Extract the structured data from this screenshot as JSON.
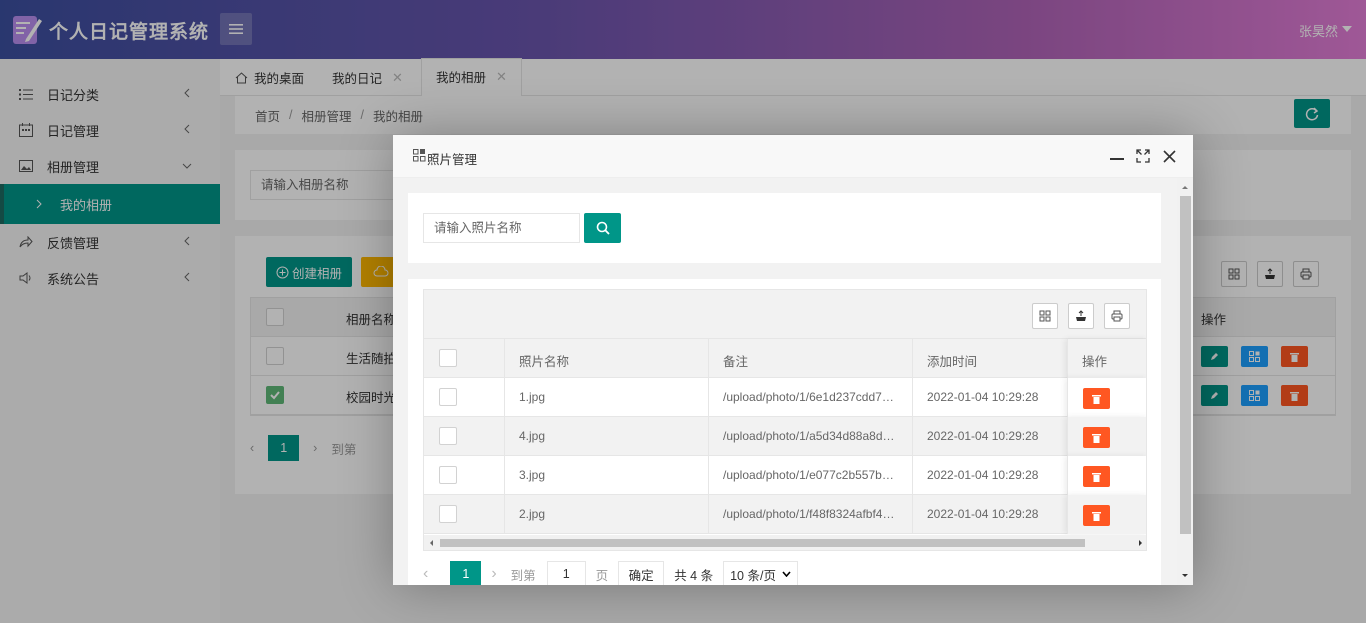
{
  "header": {
    "app_title": "个人日记管理系统",
    "user_name": "张昊然"
  },
  "sidebar": {
    "items": [
      {
        "label": "日记分类",
        "icon": "list-icon"
      },
      {
        "label": "日记管理",
        "icon": "calendar-icon"
      },
      {
        "label": "相册管理",
        "icon": "image-icon"
      },
      {
        "label": "我的相册",
        "icon": "chevron-right-icon"
      },
      {
        "label": "反馈管理",
        "icon": "share-icon"
      },
      {
        "label": "系统公告",
        "icon": "speaker-icon"
      }
    ]
  },
  "tabs": [
    {
      "label": "我的桌面"
    },
    {
      "label": "我的日记"
    },
    {
      "label": "我的相册"
    }
  ],
  "breadcrumb": [
    "首页",
    "相册管理",
    "我的相册"
  ],
  "album_page": {
    "search_placeholder": "请输入相册名称",
    "create_label": "创建相册",
    "columns": [
      "相册名称",
      "操作"
    ],
    "rows": [
      {
        "name": "生活随拍",
        "checked": false
      },
      {
        "name": "校园时光",
        "checked": true
      }
    ],
    "pager": {
      "current": "1",
      "goto": "到第"
    }
  },
  "modal": {
    "title": "照片管理",
    "search_placeholder": "请输入照片名称",
    "columns": [
      "照片名称",
      "备注",
      "添加时间",
      "操作"
    ],
    "rows": [
      {
        "name": "1.jpg",
        "note": "/upload/photo/1/6e1d237cdd7…",
        "time": "2022-01-04 10:29:28"
      },
      {
        "name": "4.jpg",
        "note": "/upload/photo/1/a5d34d88a8d…",
        "time": "2022-01-04 10:29:28"
      },
      {
        "name": "3.jpg",
        "note": "/upload/photo/1/e077c2b557b…",
        "time": "2022-01-04 10:29:28"
      },
      {
        "name": "2.jpg",
        "note": "/upload/photo/1/f48f8324afbf4…",
        "time": "2022-01-04 10:29:28"
      }
    ],
    "pager": {
      "current": "1",
      "goto_label": "到第",
      "goto_value": "1",
      "page_label": "页",
      "confirm_label": "确定",
      "total_label": "共 4 条",
      "per_page": "10 条/页"
    }
  },
  "colors": {
    "primary": "#009688",
    "danger": "#ff5722",
    "info": "#1e9fff",
    "warn": "#ffb800"
  }
}
